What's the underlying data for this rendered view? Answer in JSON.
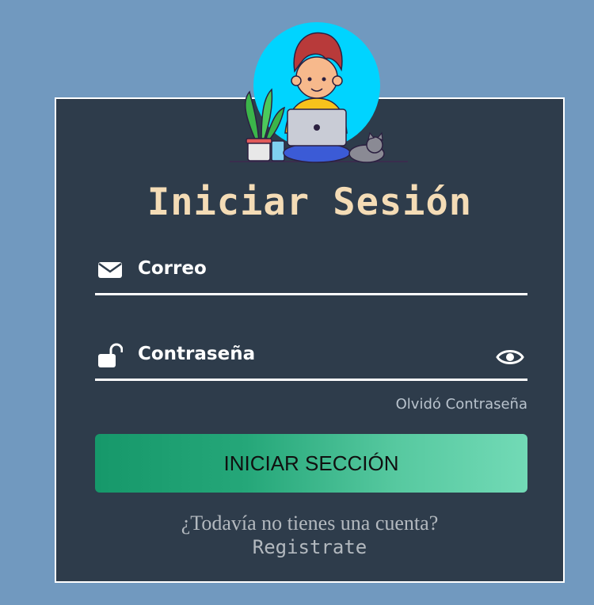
{
  "login": {
    "title": "Iniciar Sesión",
    "email_label": "Correo",
    "email_value": "",
    "password_label": "Contraseña",
    "password_value": "",
    "forgot_link": "Olvidó Contraseña",
    "submit_label": "INICIAR SECCIÓN",
    "no_account_text": "¿Todavía no tienes una cuenta?",
    "register_link": "Registrate"
  },
  "icons": {
    "email": "envelope-icon",
    "password": "unlock-icon",
    "toggle_password": "eye-icon",
    "avatar": "person-with-laptop-illustration"
  },
  "colors": {
    "page_background": "#7199bf",
    "card_background": "#2e3c4b",
    "title": "#f4dcb6",
    "button_gradient_start": "#16986a",
    "button_gradient_end": "#72dab6",
    "muted_text": "#b3b9bf"
  }
}
